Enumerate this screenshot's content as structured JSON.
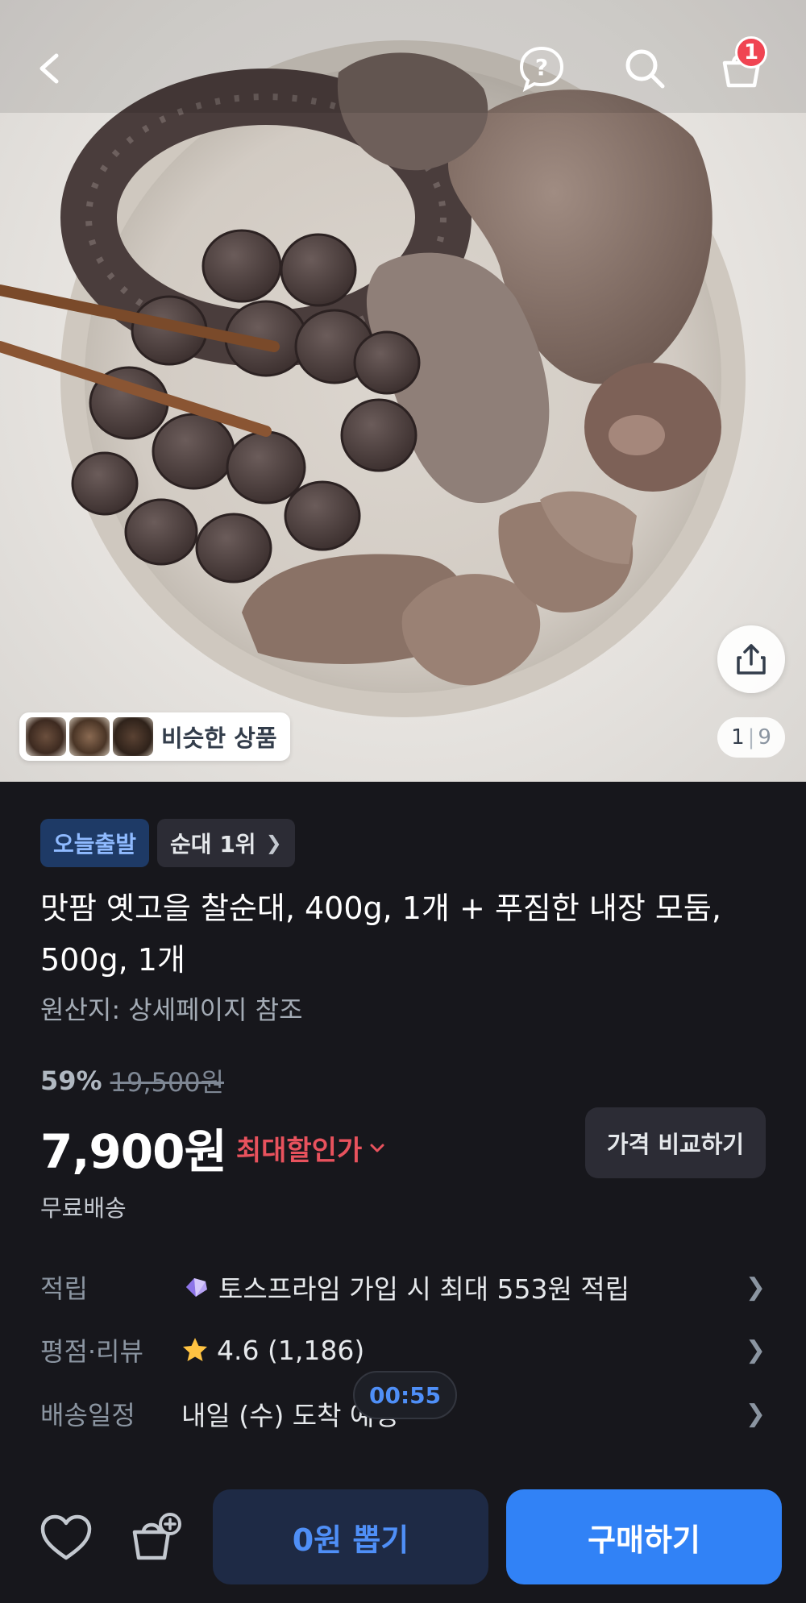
{
  "header": {
    "cart_badge": "1"
  },
  "hero": {
    "similar_label": "비슷한 상품",
    "page_current": "1",
    "page_separator": "|",
    "page_total": "9"
  },
  "tags": {
    "delivery": "오늘출발",
    "ranking": "순대 1위"
  },
  "product": {
    "title": "맛팜 옛고을 찰순대, 400g, 1개 + 푸짐한 내장 모둠, 500g, 1개",
    "origin": "원산지: 상세페이지 참조",
    "discount": "59%",
    "original_price": "19,500원",
    "price": "7,900원",
    "max_discount_label": "최대할인가",
    "compare_label": "가격 비교하기",
    "shipping": "무료배송"
  },
  "info_rows": {
    "points": {
      "label": "적립",
      "value": "토스프라임 가입 시 최대 553원 적립"
    },
    "rating": {
      "label": "평점·리뷰",
      "value": "4.6 (1,186)"
    },
    "delivery": {
      "label": "배송일정",
      "value": "내일 (수) 도착 예정"
    }
  },
  "timer": "00:55",
  "bottom": {
    "draw_label": "0원 뽑기",
    "buy_label": "구매하기"
  },
  "colors": {
    "accent_blue": "#3182f6",
    "discount_red": "#e8525d",
    "background": "#17171c"
  },
  "icons": [
    "back-arrow-icon",
    "help-bubble-icon",
    "search-icon",
    "cart-icon",
    "share-icon",
    "chevron-right-icon",
    "chevron-down-icon",
    "prime-gem-icon",
    "star-icon",
    "heart-icon",
    "add-cart-icon"
  ]
}
